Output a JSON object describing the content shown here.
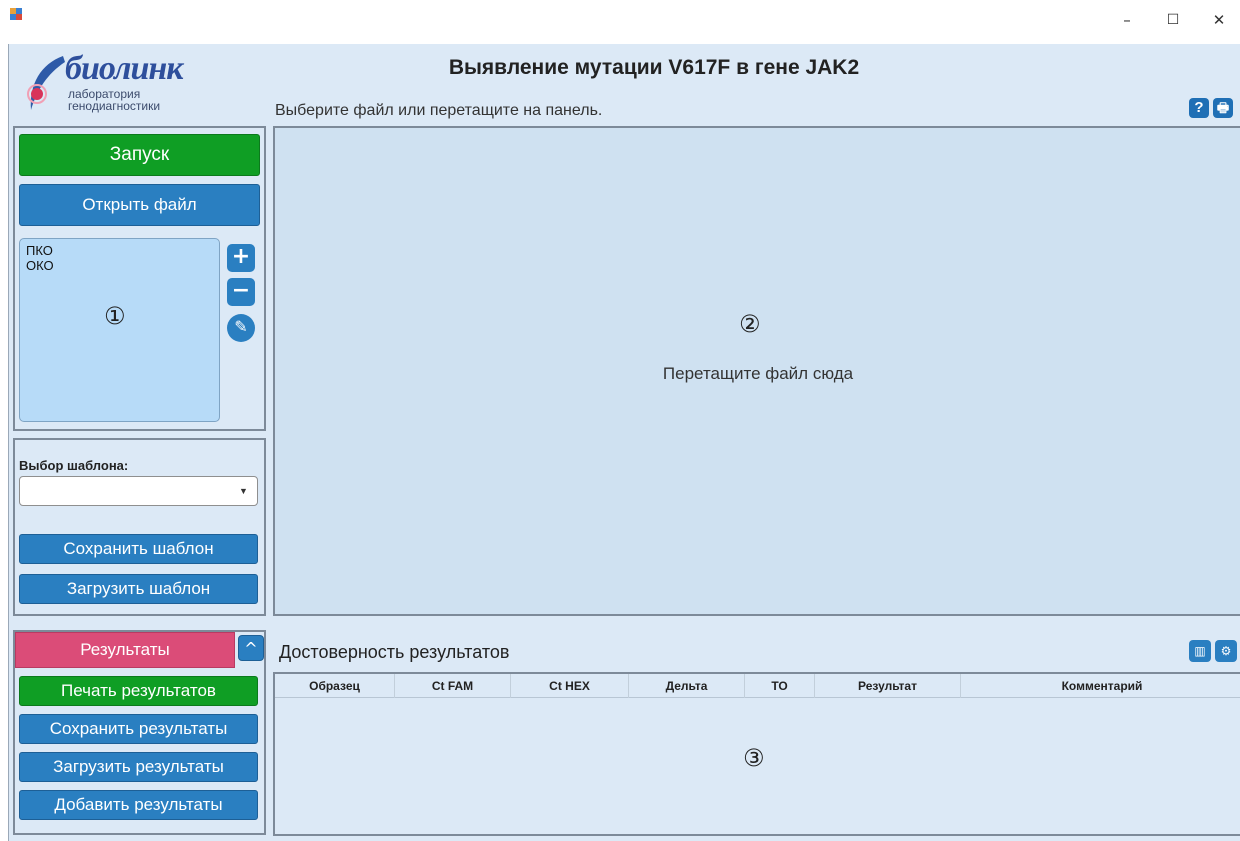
{
  "window": {
    "minimize_glyph": "–",
    "maximize_glyph": "☐",
    "close_glyph": "✕"
  },
  "logo": {
    "name": "биолинк",
    "line1": "лаборатория",
    "line2": "генодиагностики"
  },
  "header": {
    "title": "Выявление мутации V617F в гене JAK2",
    "hint": "Выберите файл или перетащите на панель.",
    "help_glyph": "?",
    "print_glyph": "🖶"
  },
  "left": {
    "run_label": "Запуск",
    "open_label": "Открыть файл",
    "samples": [
      "ПКО",
      "ОКО"
    ],
    "marker1": "①",
    "add_glyph": "+",
    "remove_glyph": "−",
    "edit_glyph": "✎",
    "template_label": "Выбор шаблона:",
    "template_value": "",
    "save_template_label": "Сохранить шаблон",
    "load_template_label": "Загрузить шаблон",
    "results_label": "Результаты",
    "print_results_label": "Печать результатов",
    "save_results_label": "Сохранить результаты",
    "load_results_label": "Загрузить результаты",
    "add_results_label": "Добавить результаты"
  },
  "dropzone": {
    "marker2": "②",
    "text": "Перетащите файл сюда"
  },
  "results": {
    "title": "Достоверность результатов",
    "marker3": "③",
    "columns": [
      "Образец",
      "Ct FAM",
      "Ct HEX",
      "Дельта",
      "ТО",
      "Результат",
      "Комментарий"
    ]
  },
  "colors": {
    "accent_blue": "#2a7fc1",
    "run_green": "#0f9e24",
    "results_pink": "#db4c78",
    "panel_bg": "#dce9f6"
  }
}
